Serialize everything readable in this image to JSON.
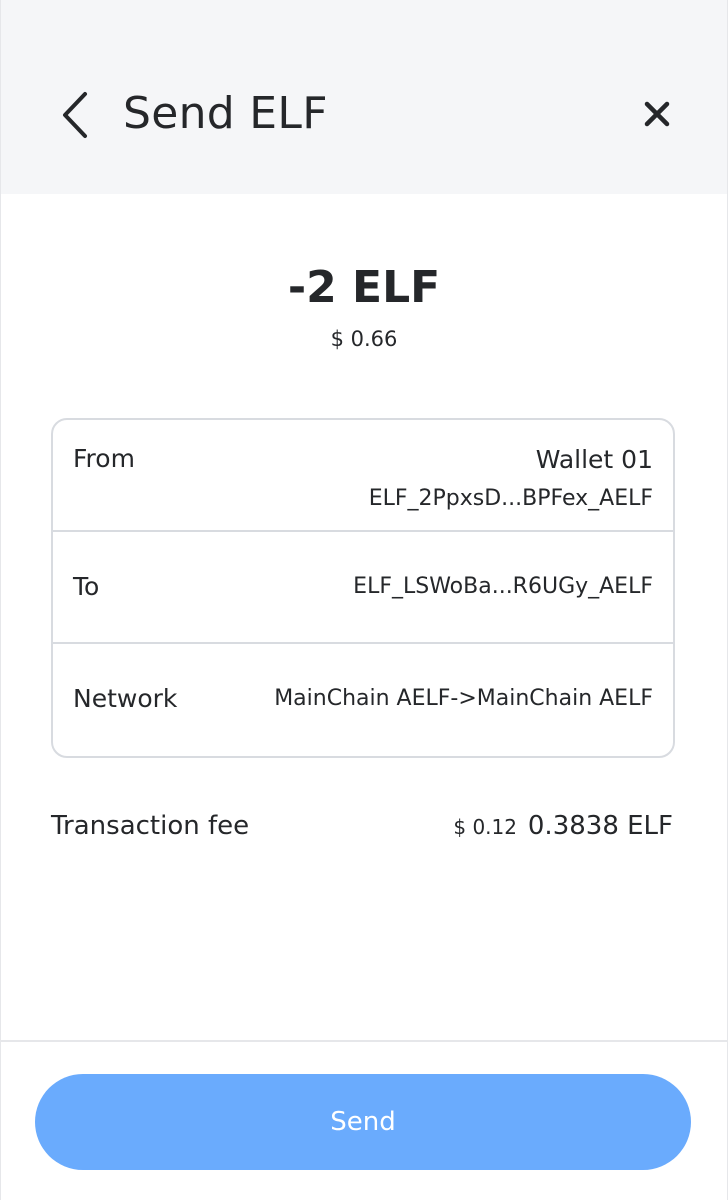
{
  "header": {
    "title": "Send ELF",
    "back_icon": "chevron-left-icon",
    "close_icon": "close-icon"
  },
  "summary": {
    "amount": "-2 ELF",
    "amount_usd": "$ 0.66"
  },
  "details": {
    "from_label": "From",
    "from_wallet": "Wallet 01",
    "from_address": "ELF_2PpxsD...BPFex_AELF",
    "to_label": "To",
    "to_address": "ELF_LSWoBa...R6UGy_AELF",
    "network_label": "Network",
    "network_value": "MainChain AELF->MainChain AELF"
  },
  "fee": {
    "label": "Transaction fee",
    "usd": "$ 0.12",
    "elf": "0.3838 ELF"
  },
  "footer": {
    "send_label": "Send"
  },
  "colors": {
    "header_bg": "#f5f6f8",
    "text": "#25272a",
    "border": "#d8dbe0",
    "send_button": "#6aabfd"
  }
}
